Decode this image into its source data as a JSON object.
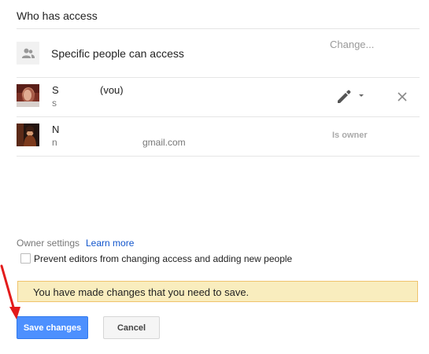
{
  "dialog": {
    "title": "Who has access"
  },
  "link_sharing": {
    "icon": "people-icon",
    "label": "Specific people can access",
    "change_label": "Change..."
  },
  "people": [
    {
      "name": "S… (you)",
      "name_prefix": "S",
      "name_suffix": "(vou)",
      "email_prefix": "s",
      "permission_icon": "pencil-icon",
      "remove_icon": "close-icon"
    },
    {
      "name_prefix": "N",
      "email_prefix": "n",
      "email_suffix": "gmail.com",
      "role_label": "Is owner"
    }
  ],
  "owner_settings": {
    "label": "Owner settings",
    "learn_more": "Learn more",
    "checkbox_label": "Prevent editors from changing access and adding new people",
    "checkbox_checked": false
  },
  "notice": {
    "text": "You have made changes that you need to save.",
    "background": "#f9edbe"
  },
  "actions": {
    "save_label": "Save changes",
    "cancel_label": "Cancel",
    "save_color": "#4d90fe"
  },
  "annotation": {
    "arrow_color": "#e31b1b"
  }
}
